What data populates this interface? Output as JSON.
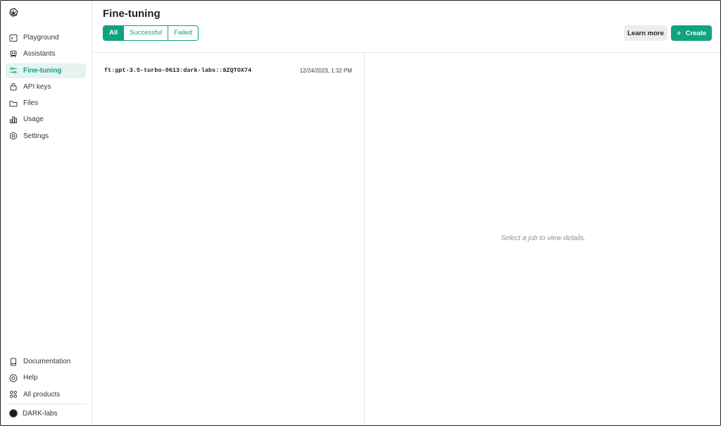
{
  "page": {
    "title": "Fine-tuning"
  },
  "sidebar": {
    "items": [
      {
        "label": "Playground",
        "icon": "terminal-icon"
      },
      {
        "label": "Assistants",
        "icon": "robot-icon"
      },
      {
        "label": "Fine-tuning",
        "icon": "sliders-icon",
        "active": true
      },
      {
        "label": "API keys",
        "icon": "lock-icon"
      },
      {
        "label": "Files",
        "icon": "folder-icon"
      },
      {
        "label": "Usage",
        "icon": "bar-chart-icon"
      },
      {
        "label": "Settings",
        "icon": "gear-icon"
      }
    ],
    "bottom_items": [
      {
        "label": "Documentation",
        "icon": "book-icon"
      },
      {
        "label": "Help",
        "icon": "help-icon"
      },
      {
        "label": "All products",
        "icon": "grid-icon"
      }
    ],
    "org": "DARK-labs"
  },
  "filters": {
    "all": "All",
    "successful": "Successful",
    "failed": "Failed",
    "selected": "All"
  },
  "actions": {
    "learn_more": "Learn more",
    "create": "Create"
  },
  "jobs": [
    {
      "name": "ft:gpt-3.5-turbo-0613:dark-labs::8ZQTOX74",
      "date": "12/24/2023, 1:32 PM"
    }
  ],
  "detail": {
    "empty_text": "Select a job to view details."
  },
  "colors": {
    "accent": "#10a37f",
    "active_bg": "#e6f3f0"
  }
}
